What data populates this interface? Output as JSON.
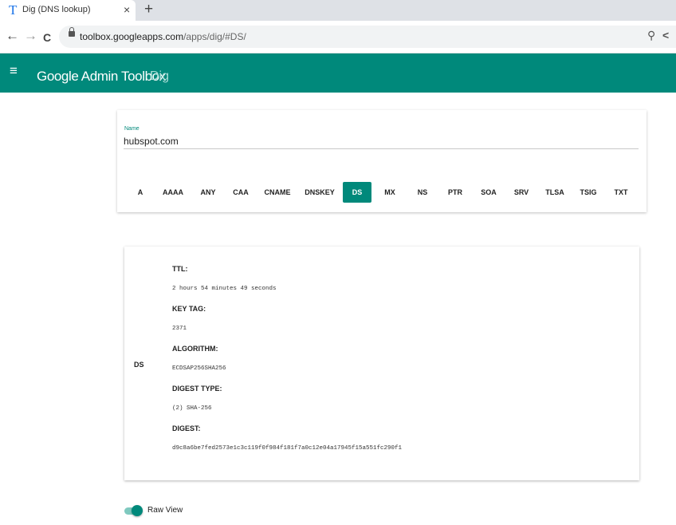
{
  "browser": {
    "tab_title": "Dig (DNS lookup)",
    "tab_favicon": "T",
    "close_glyph": "×",
    "new_tab_glyph": "+",
    "url_host": "toolbox.googleapps.com",
    "url_path": "/apps/dig/#DS/"
  },
  "icons": {
    "back": "←",
    "forward": "→",
    "reload": "C",
    "zoom": "⚲",
    "share": "<",
    "menu": "≡"
  },
  "header": {
    "title": "Google Admin Toolbox",
    "subtitle": "Dig"
  },
  "query": {
    "name_label": "Name",
    "name_value": "hubspot.com",
    "record_types": [
      "A",
      "AAAA",
      "ANY",
      "CAA",
      "CNAME",
      "DNSKEY",
      "DS",
      "MX",
      "NS",
      "PTR",
      "SOA",
      "SRV",
      "TLSA",
      "TSIG",
      "TXT"
    ],
    "selected": "DS"
  },
  "result": {
    "record_type": "DS",
    "fields": [
      {
        "label": "TTL:",
        "value": "2 hours 54 minutes 49 seconds"
      },
      {
        "label": "KEY TAG:",
        "value": "2371"
      },
      {
        "label": "ALGORITHM:",
        "value": "ECDSAP256SHA256"
      },
      {
        "label": "DIGEST TYPE:",
        "value": "(2) SHA-256"
      },
      {
        "label": "DIGEST:",
        "value": "d9c8a6be7fed2573e1c3c119f0f984f181f7a0c12e04a17945f15a551fc290f1"
      }
    ]
  },
  "raw_view": {
    "label": "Raw View",
    "enabled": true
  },
  "colors": {
    "accent": "#00897b",
    "tab_strip": "#dee1e6"
  }
}
